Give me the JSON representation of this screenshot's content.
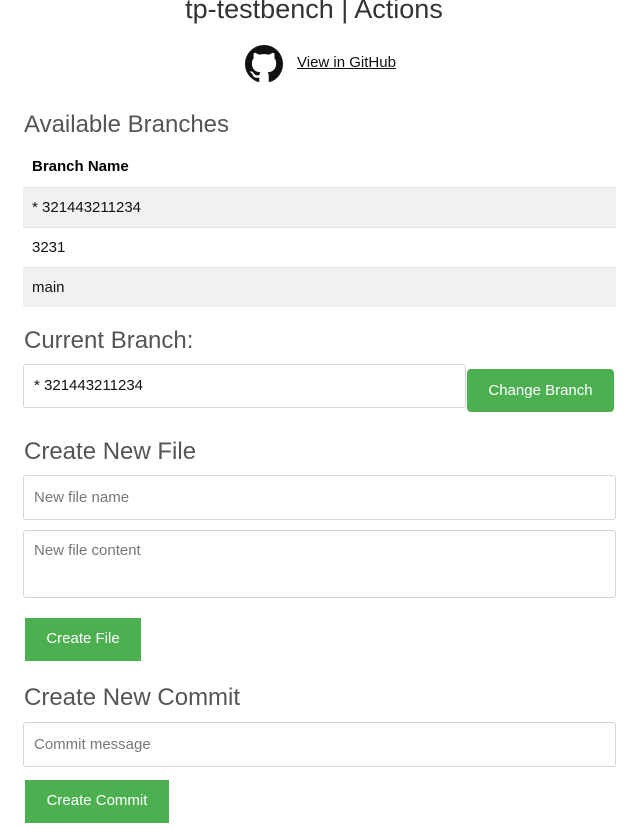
{
  "header": {
    "title": "tp-testbench | Actions",
    "github_link": "View in GitHub"
  },
  "branches": {
    "heading": "Available Branches",
    "column_header": "Branch Name",
    "rows": [
      "* 321443211234",
      "3231",
      "main"
    ]
  },
  "current_branch": {
    "heading": "Current Branch:",
    "value": "* 321443211234",
    "button": "Change Branch"
  },
  "create_file": {
    "heading": "Create New File",
    "name_placeholder": "New file name",
    "content_placeholder": "New file content",
    "button": "Create File"
  },
  "create_commit": {
    "heading": "Create New Commit",
    "message_placeholder": "Commit message",
    "button": "Create Commit"
  },
  "colors": {
    "button_green": "#4caf50",
    "heading_gray": "#555555",
    "row_stripe": "#f1f1f1"
  },
  "icons": {
    "github": "github-octocat-icon"
  }
}
